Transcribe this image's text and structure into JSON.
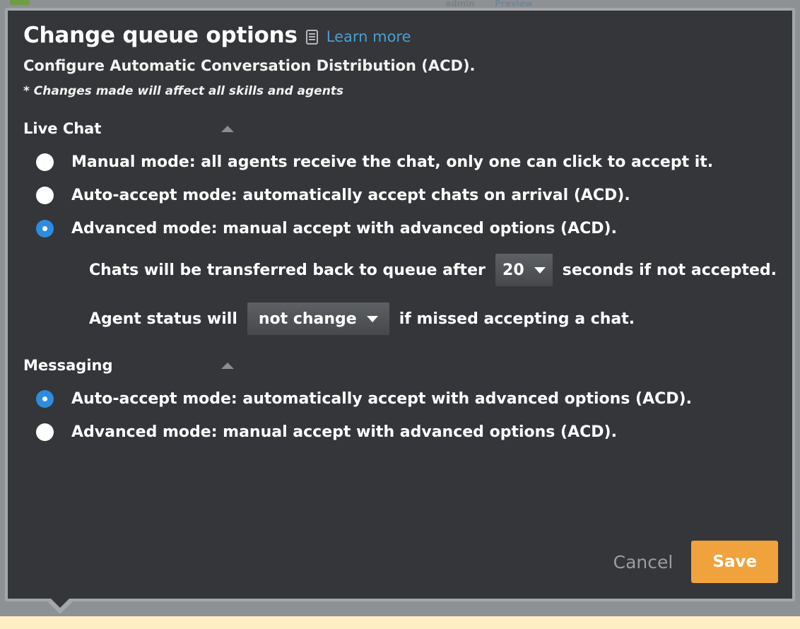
{
  "background": {
    "faint_text_1": "admin",
    "faint_text_2": "Preview",
    "accent_green": "#6f9c45",
    "strip_color": "#fdeec4"
  },
  "popover": {
    "title": "Change queue options",
    "doc_icon": "document-icon",
    "learn_more": "Learn more",
    "subtitle": "Configure Automatic Conversation Distribution (ACD).",
    "note": "* Changes made will affect all skills and agents"
  },
  "sections": [
    {
      "id": "live-chat",
      "title": "Live Chat",
      "collapse_icon": "chevron-up-icon",
      "options": [
        {
          "id": "manual",
          "label": "Manual mode: all agents receive the chat, only one can click to accept it.",
          "selected": false
        },
        {
          "id": "auto-accept",
          "label": "Auto-accept mode: automatically accept chats on arrival (ACD).",
          "selected": false
        },
        {
          "id": "advanced",
          "label": "Advanced mode: manual accept with advanced options (ACD).",
          "selected": true
        }
      ],
      "sub_rows": [
        {
          "id": "transfer-timeout",
          "prefix": "Chats will be transferred back to queue after",
          "select_value": "20",
          "suffix": "seconds if not accepted."
        },
        {
          "id": "agent-status",
          "prefix": "Agent status will",
          "select_value": "not change",
          "suffix": "if missed accepting a chat."
        }
      ]
    },
    {
      "id": "messaging",
      "title": "Messaging",
      "collapse_icon": "chevron-up-icon",
      "options": [
        {
          "id": "msg-auto-accept",
          "label": "Auto-accept mode: automatically accept with advanced options (ACD).",
          "selected": true
        },
        {
          "id": "msg-advanced",
          "label": "Advanced mode: manual accept with advanced options (ACD).",
          "selected": false
        }
      ]
    }
  ],
  "footer": {
    "cancel_label": "Cancel",
    "save_label": "Save",
    "save_color": "#f0a23c"
  }
}
